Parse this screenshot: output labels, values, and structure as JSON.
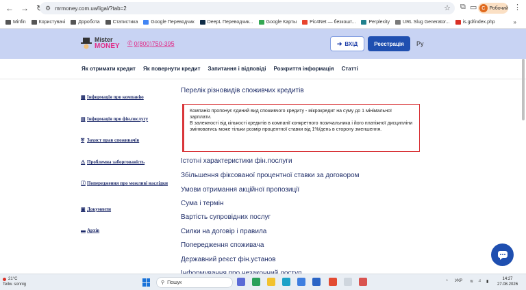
{
  "browser": {
    "url": "mrmoney.com.ua/ligal/?tab=2",
    "profile_name": "Робочий",
    "profile_initial": "С",
    "bookmarks": [
      "Minfin",
      "Користувачі",
      "Доробота",
      "Статистика",
      "Google Переводчик",
      "DeepL Переводчик...",
      "Google Карты",
      "Pic4Net — безкошт...",
      "Perplexity",
      "URL Slug Generator...",
      "is.gd/index.php"
    ]
  },
  "header": {
    "logo_line1": "Mister",
    "logo_line2": "MONEY",
    "phone": "0(800)750-395",
    "login_label": "ВХІД",
    "register_label": "Реєстрація",
    "lang": "Ру"
  },
  "nav": [
    "Як отримати кредит",
    "Як повернути кредит",
    "Запитання і відповіді",
    "Розкриття інформація",
    "Статті"
  ],
  "sidebar": [
    {
      "label": "Інформація про компанію",
      "icon": "building-icon"
    },
    {
      "label": "Інформація про фін.послугу",
      "icon": "document-icon"
    },
    {
      "label": "Захист прав споживачів",
      "icon": "shield-icon"
    },
    {
      "label": "Проблемна заборгованість",
      "icon": "warning-icon"
    },
    {
      "label": "Попередження про можливі наслідки",
      "icon": "info-icon"
    },
    {
      "label": "Документи",
      "icon": "file-icon"
    },
    {
      "label": "Архів",
      "icon": "archive-icon"
    }
  ],
  "content": {
    "heading": "Перелік різновидів споживчих кредитів",
    "notice_p1": "Компанія пропонує єдиний вид споживчого кредиту - мікрокредит на суму до 1 мінімальної зарплати.",
    "notice_p2": "В залежності від кількості кредитів в компанії конкретного позичальника і його платіжної дисципліни змінюватись може тільки розмір процентної ставки від 1%/день в сторону зменшення.",
    "links": [
      "Істотні характеристики фін.послуги",
      "Збільшення фіксованої процентної ставки за договором",
      "Умови отримання акційної пропозиції",
      "Сума і термін",
      "Вартість супровідних послуг",
      "Силки на договір і правила",
      "Попередження споживача",
      "Державний реєст фін.установ",
      "Інформування про незаконний доступ"
    ]
  },
  "taskbar": {
    "temp": "21°C",
    "weather": "Teilw. sonnig",
    "search_placeholder": "Пошук",
    "lang": "УКР",
    "time": "14:27",
    "date": "27.08.2026"
  },
  "colors": {
    "header_bg": "#c8d3f3",
    "brand_blue": "#1f4fb0",
    "brand_pink": "#e0308a",
    "notice_border": "#d9363a"
  }
}
